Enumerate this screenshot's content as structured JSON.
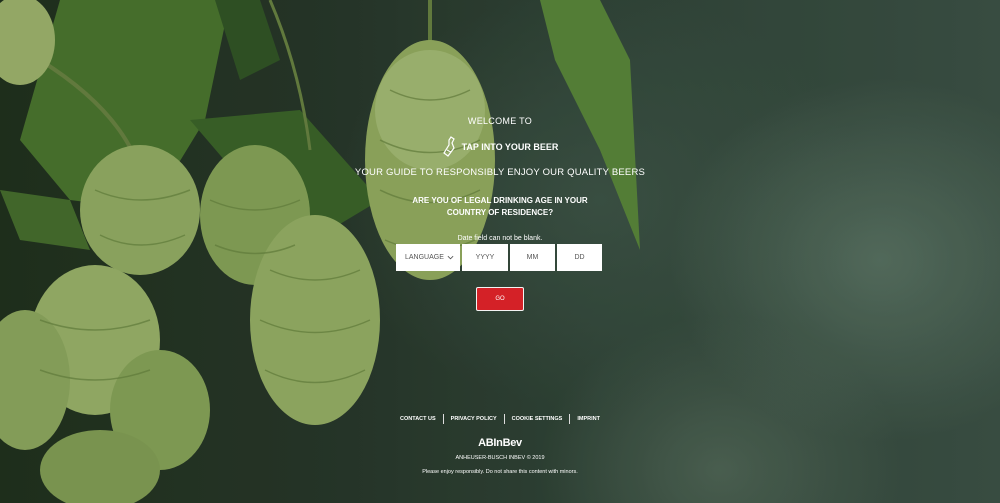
{
  "background": {
    "subject": "hops-cones-icon",
    "colors": {
      "dark": "#1f2d22",
      "leaf": "#5a8a3a",
      "hop": "#9cb86a"
    }
  },
  "gate": {
    "welcome": "WELCOME TO",
    "brand_name": "TAP INTO YOUR BEER",
    "brand_icon": "beer-bottle-icon",
    "tagline": "YOUR GUIDE TO RESPONSIBLY ENJOY OUR QUALITY BEERS",
    "question": "ARE YOU OF LEGAL DRINKING AGE IN YOUR COUNTRY OF RESIDENCE?",
    "error": "Date field can not be blank.",
    "language_label": "LANGUAGE",
    "year_placeholder": "YYYY",
    "month_placeholder": "MM",
    "day_placeholder": "DD",
    "submit_label": "GO",
    "accent": "#d42127"
  },
  "footer": {
    "links": [
      "CONTACT US",
      "PRIVACY POLICY",
      "COOKIE SETTINGS",
      "IMPRINT"
    ],
    "logo": "ABInBev",
    "copyright": "ANHEUSER-BUSCH INBEV © 2019",
    "notice": "Please enjoy responsibly. Do not share this content with minors."
  }
}
